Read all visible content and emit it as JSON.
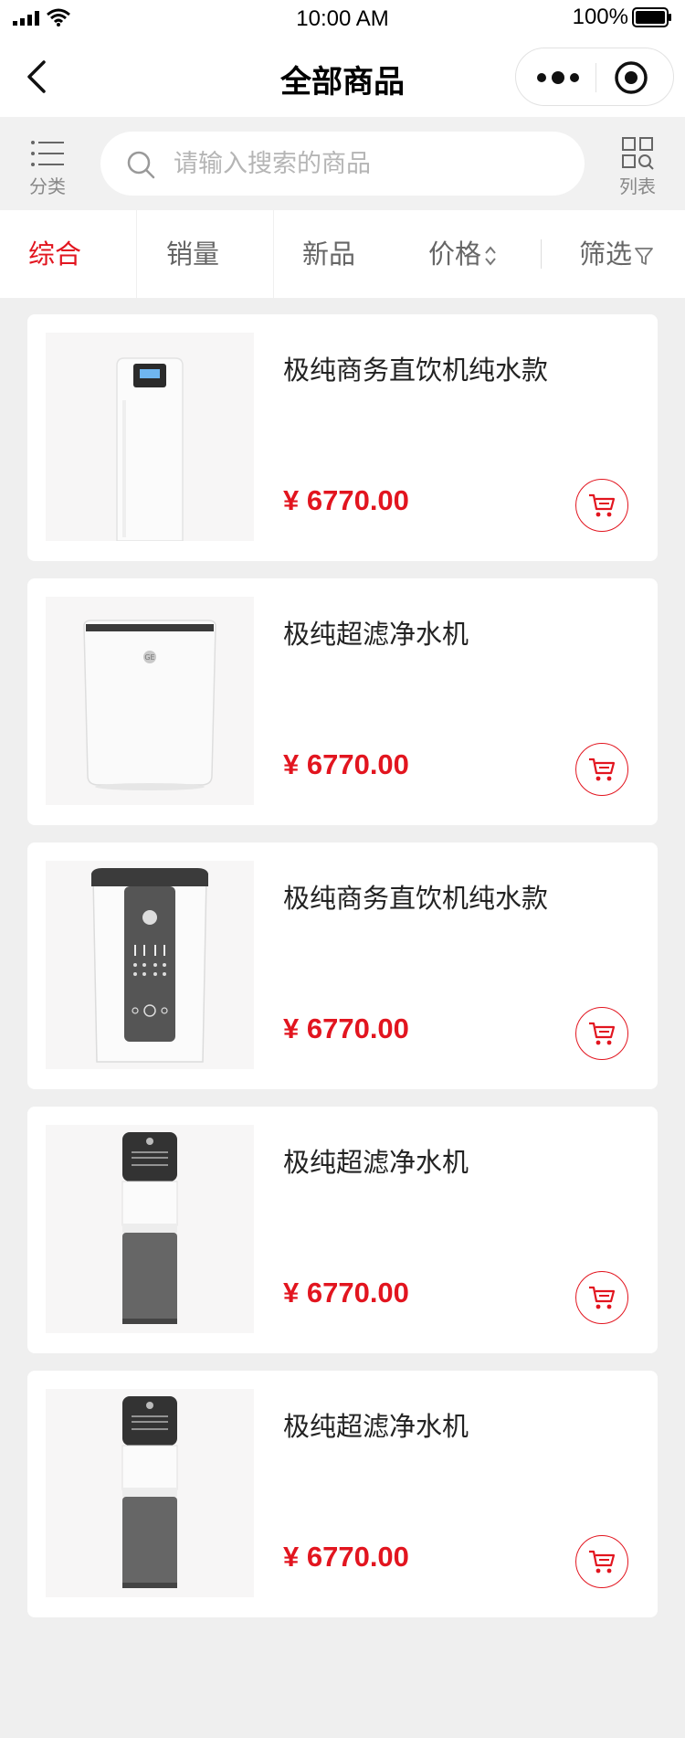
{
  "status_bar": {
    "time": "10:00 AM",
    "battery_percent": "100%",
    "icons": [
      "signal-icon",
      "wifi-icon",
      "battery-icon"
    ]
  },
  "nav": {
    "title": "全部商品",
    "icons": [
      "back-arrow-icon",
      "more-dots-icon",
      "target-icon"
    ]
  },
  "search": {
    "category_label": "分类",
    "placeholder": "请输入搜索的商品",
    "value": "",
    "view_label": "列表",
    "icons": [
      "list-icon",
      "search-icon",
      "grid-search-icon"
    ]
  },
  "sort": {
    "tabs": [
      {
        "label": "综合",
        "active": true
      },
      {
        "label": "销量",
        "active": false
      },
      {
        "label": "新品",
        "active": false
      },
      {
        "label": "价格",
        "active": false,
        "icon": "sort-updown-icon"
      },
      {
        "label": "筛选",
        "active": false,
        "icon": "filter-funnel-icon"
      }
    ]
  },
  "colors": {
    "accent": "#e2151f",
    "page_bg": "#efefef",
    "search_row_bg": "#f1f1f1",
    "card_bg": "#ffffff"
  },
  "products": [
    {
      "name": "极纯商务直饮机纯水款",
      "price": "¥ 6770.00",
      "image": "tall-white-water-dispenser"
    },
    {
      "name": "极纯超滤净水机",
      "price": "¥ 6770.00",
      "image": "white-purifier-with-ge-logo"
    },
    {
      "name": "极纯商务直饮机纯水款",
      "price": "¥ 6770.00",
      "image": "white-dispenser-with-dark-control-panel"
    },
    {
      "name": "极纯超滤净水机",
      "price": "¥ 6770.00",
      "image": "floor-standing-gray-dispenser"
    },
    {
      "name": "极纯超滤净水机",
      "price": "¥ 6770.00",
      "image": "floor-standing-gray-dispenser"
    }
  ]
}
